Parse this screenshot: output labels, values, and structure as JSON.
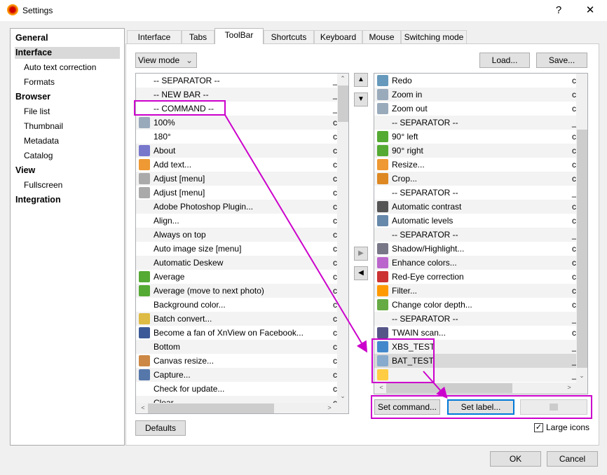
{
  "window": {
    "title": "Settings",
    "help": "?",
    "close": "✕"
  },
  "sidebar": [
    {
      "label": "General",
      "type": "cat"
    },
    {
      "label": "Interface",
      "type": "cat",
      "selected": true
    },
    {
      "label": "Auto text correction",
      "type": "sub"
    },
    {
      "label": "Formats",
      "type": "sub"
    },
    {
      "label": "Browser",
      "type": "cat"
    },
    {
      "label": "File list",
      "type": "sub"
    },
    {
      "label": "Thumbnail",
      "type": "sub"
    },
    {
      "label": "Metadata",
      "type": "sub"
    },
    {
      "label": "Catalog",
      "type": "sub"
    },
    {
      "label": "View",
      "type": "cat"
    },
    {
      "label": "Fullscreen",
      "type": "sub"
    },
    {
      "label": "Integration",
      "type": "cat"
    }
  ],
  "tabs": [
    {
      "label": "Interface"
    },
    {
      "label": "Tabs"
    },
    {
      "label": "ToolBar",
      "active": true
    },
    {
      "label": "Shortcuts"
    },
    {
      "label": "Keyboard"
    },
    {
      "label": "Mouse"
    },
    {
      "label": "Switching mode"
    }
  ],
  "toolbar": {
    "mode_select": "View mode",
    "load": "Load...",
    "save": "Save...",
    "defaults": "Defaults",
    "set_command": "Set command...",
    "set_label": "Set label...",
    "large_icons": "Large icons",
    "large_icons_checked": true,
    "ok": "OK",
    "cancel": "Cancel"
  },
  "left_list": [
    {
      "label": "-- SEPARATOR --",
      "mark": "_"
    },
    {
      "label": "-- NEW BAR --",
      "mark": "_"
    },
    {
      "label": "-- COMMAND --",
      "mark": "_"
    },
    {
      "label": "100%",
      "icon": "zoom-100-icon",
      "mark": "c"
    },
    {
      "label": "180°",
      "mark": "c"
    },
    {
      "label": "About",
      "icon": "help-icon",
      "mark": "c"
    },
    {
      "label": "Add text...",
      "icon": "add-text-icon",
      "mark": "c"
    },
    {
      "label": "Adjust [menu]",
      "icon": "adjust-icon",
      "mark": "c"
    },
    {
      "label": "Adjust [menu]",
      "icon": "adjust-icon",
      "mark": "c"
    },
    {
      "label": "Adobe Photoshop Plugin...",
      "mark": "c"
    },
    {
      "label": "Align...",
      "mark": "c"
    },
    {
      "label": "Always on top",
      "mark": "c"
    },
    {
      "label": "Auto image size [menu]",
      "mark": "c"
    },
    {
      "label": "Automatic Deskew",
      "mark": "c"
    },
    {
      "label": "Average",
      "icon": "star-icon",
      "mark": "c"
    },
    {
      "label": "Average (move to next photo)",
      "icon": "star-icon",
      "mark": "c"
    },
    {
      "label": "Background color...",
      "mark": "c"
    },
    {
      "label": "Batch convert...",
      "icon": "batch-icon",
      "mark": "c"
    },
    {
      "label": "Become a fan of XnView on Facebook...",
      "icon": "facebook-icon",
      "mark": "c"
    },
    {
      "label": "Bottom",
      "mark": "c"
    },
    {
      "label": "Canvas resize...",
      "icon": "canvas-icon",
      "mark": "c"
    },
    {
      "label": "Capture...",
      "icon": "camera-icon",
      "mark": "c"
    },
    {
      "label": "Check for update...",
      "mark": "c"
    },
    {
      "label": "Clear",
      "mark": "c"
    }
  ],
  "right_list": [
    {
      "label": "Redo",
      "icon": "redo-icon",
      "mark": "c"
    },
    {
      "label": "Zoom in",
      "icon": "zoom-in-icon",
      "mark": "c"
    },
    {
      "label": "Zoom out",
      "icon": "zoom-out-icon",
      "mark": "c"
    },
    {
      "label": "-- SEPARATOR --",
      "mark": "_"
    },
    {
      "label": "90° left",
      "icon": "rotate-left-icon",
      "mark": "c"
    },
    {
      "label": "90° right",
      "icon": "rotate-right-icon",
      "mark": "c"
    },
    {
      "label": "Resize...",
      "icon": "resize-icon",
      "mark": "c"
    },
    {
      "label": "Crop...",
      "icon": "crop-icon",
      "mark": "c"
    },
    {
      "label": "-- SEPARATOR --",
      "mark": "_"
    },
    {
      "label": "Automatic contrast",
      "icon": "contrast-icon",
      "mark": "c"
    },
    {
      "label": "Automatic levels",
      "icon": "levels-icon",
      "mark": "c"
    },
    {
      "label": "-- SEPARATOR --",
      "mark": "_"
    },
    {
      "label": "Shadow/Highlight...",
      "icon": "shadow-icon",
      "mark": "c"
    },
    {
      "label": "Enhance colors...",
      "icon": "enhance-icon",
      "mark": "c"
    },
    {
      "label": "Red-Eye correction",
      "icon": "redeye-icon",
      "mark": "c"
    },
    {
      "label": "Filter...",
      "icon": "filter-icon",
      "mark": "c"
    },
    {
      "label": "Change color depth...",
      "icon": "color-depth-icon",
      "mark": "c"
    },
    {
      "label": "-- SEPARATOR --",
      "mark": "_"
    },
    {
      "label": "TWAIN scan...",
      "icon": "scanner-icon",
      "mark": "c"
    },
    {
      "label": "XBS_TEST",
      "icon": "xbs-icon",
      "mark": "_"
    },
    {
      "label": "BAT_TEST",
      "icon": "bat-icon",
      "mark": "_",
      "selected": true
    },
    {
      "label": "",
      "icon": "folder-icon",
      "mark": "_"
    }
  ],
  "colors": {
    "annotation": "#cc00cc",
    "focus": "#0078d7"
  }
}
